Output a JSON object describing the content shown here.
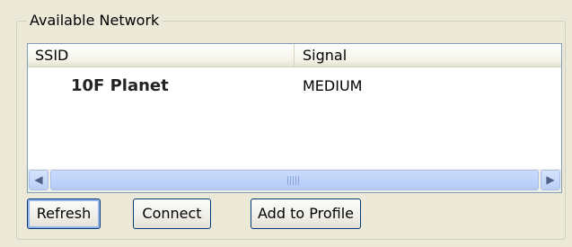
{
  "group": {
    "title": "Available Network"
  },
  "list": {
    "columns": [
      "SSID",
      "Signal"
    ],
    "rows": [
      {
        "ssid": "10F Planet",
        "signal": "MEDIUM"
      }
    ]
  },
  "scrollbar": {
    "left_icon": "scroll-left-arrow-icon",
    "right_icon": "scroll-right-arrow-icon",
    "left_glyph": "◀",
    "right_glyph": "▶"
  },
  "buttons": {
    "refresh": "Refresh",
    "connect": "Connect",
    "add_to_profile": "Add to Profile"
  },
  "colors": {
    "window_bg": "#ece9d8",
    "list_border": "#7f9db9",
    "button_border": "#003c74",
    "scroll_blue": "#b9cff8"
  }
}
